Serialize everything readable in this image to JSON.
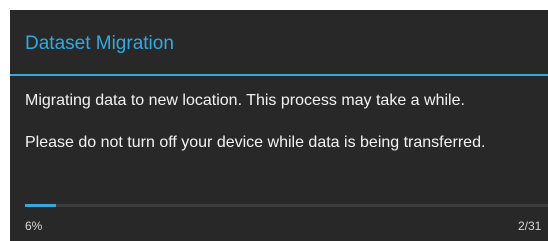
{
  "dialog": {
    "title": "Dataset Migration",
    "message_line_1": "Migrating data to new location. This process may take a while.",
    "message_line_2": "Please do not turn off your device while data is being transferred.",
    "progress": {
      "percent_label": "6%",
      "fraction": 0.06,
      "count_label": "2/31"
    }
  },
  "colors": {
    "accent": "#33a9e0",
    "dialog_background": "#282828",
    "text": "#f2f2f2"
  }
}
